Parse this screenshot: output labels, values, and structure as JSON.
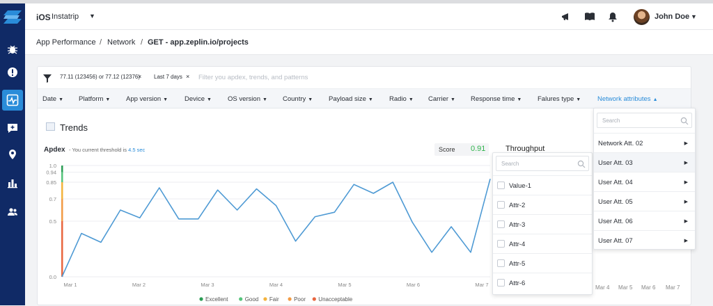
{
  "header": {
    "os": "iOS",
    "app_name": "Instatrip",
    "user_name": "John Doe"
  },
  "breadcrumb": {
    "items": [
      "App Performance",
      "Network"
    ],
    "current": "GET - app.zeplin.io/projects",
    "separator": "/"
  },
  "filters": {
    "chips": [
      "77.11 (123456) or 77.12 (12376)",
      "Last 7 days"
    ],
    "placeholder": "Filter you apdex, trends, and patterns"
  },
  "dimensions": [
    "Date",
    "Platform",
    "App version",
    "Device",
    "OS version",
    "Country",
    "Payload size",
    "Radio",
    "Carrier",
    "Response time",
    "Falures type",
    "Network attributes"
  ],
  "trends": {
    "title": "Trends",
    "apdex_title": "Apdex",
    "apdex_note": "- You current threshold is",
    "threshold": "4.5 sec",
    "score_label": "Score",
    "score_value": "0.91",
    "score_color": "#2fb44b",
    "throughput_title": "Throughput",
    "throughput_x": [
      "Mar 4",
      "Mar 5",
      "Mar 6",
      "Mar 7"
    ]
  },
  "chart_data": {
    "type": "line",
    "title": "Apdex",
    "x": [
      "Mar 1",
      "Mar 2",
      "Mar 3",
      "Mar 4",
      "Mar 5",
      "Mar 6",
      "Mar 7"
    ],
    "yticks": [
      0.0,
      0.5,
      0.7,
      0.85,
      0.94,
      1.0
    ],
    "ylim": [
      0,
      1
    ],
    "series": [
      {
        "color": "#4e9ad4",
        "values": [
          0.0,
          0.39,
          0.31,
          0.6,
          0.53,
          0.8,
          0.52,
          0.52,
          0.78,
          0.6,
          0.79,
          0.64,
          0.32,
          0.54,
          0.58,
          0.83,
          0.75,
          0.85,
          0.49,
          0.22,
          0.45,
          0.22,
          0.88
        ]
      }
    ],
    "legend": [
      {
        "label": "Excellent",
        "color": "#2a9d54"
      },
      {
        "label": "Good",
        "color": "#54c47b"
      },
      {
        "label": "Fair",
        "color": "#f3b33d"
      },
      {
        "label": "Poor",
        "color": "#f29b45"
      },
      {
        "label": "Unacceptable",
        "color": "#e8663f"
      }
    ],
    "grid": true,
    "legend_position": "bottom"
  },
  "attr_dropdown": {
    "search_placeholder": "Search",
    "items": [
      "Value-1",
      "Attr-2",
      "Attr-3",
      "Attr-4",
      "Attr-5",
      "Attr-6"
    ]
  },
  "network_dropdown": {
    "search_placeholder": "Search",
    "items": [
      "Network Att. 02",
      "User Att. 03",
      "User Att. 04",
      "User Att. 05",
      "User Att. 06",
      "User Att. 07"
    ]
  },
  "colors": {
    "sidebar": "#102a66",
    "accent": "#2a8cd9"
  }
}
